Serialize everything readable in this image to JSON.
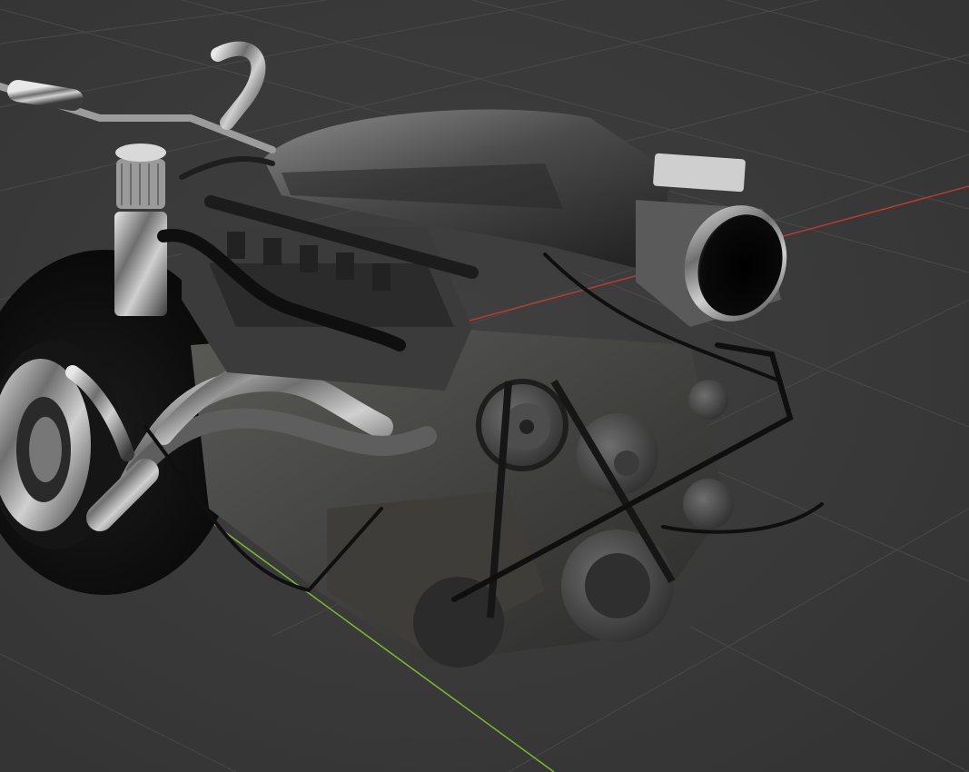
{
  "viewport": {
    "mode": "3d-viewport",
    "background_color": "#3a3a3a",
    "grid_color": "#4a4a4a",
    "x_axis_color": "#c0392b",
    "y_axis_color": "#7cbb2e",
    "object": "engine-model"
  }
}
